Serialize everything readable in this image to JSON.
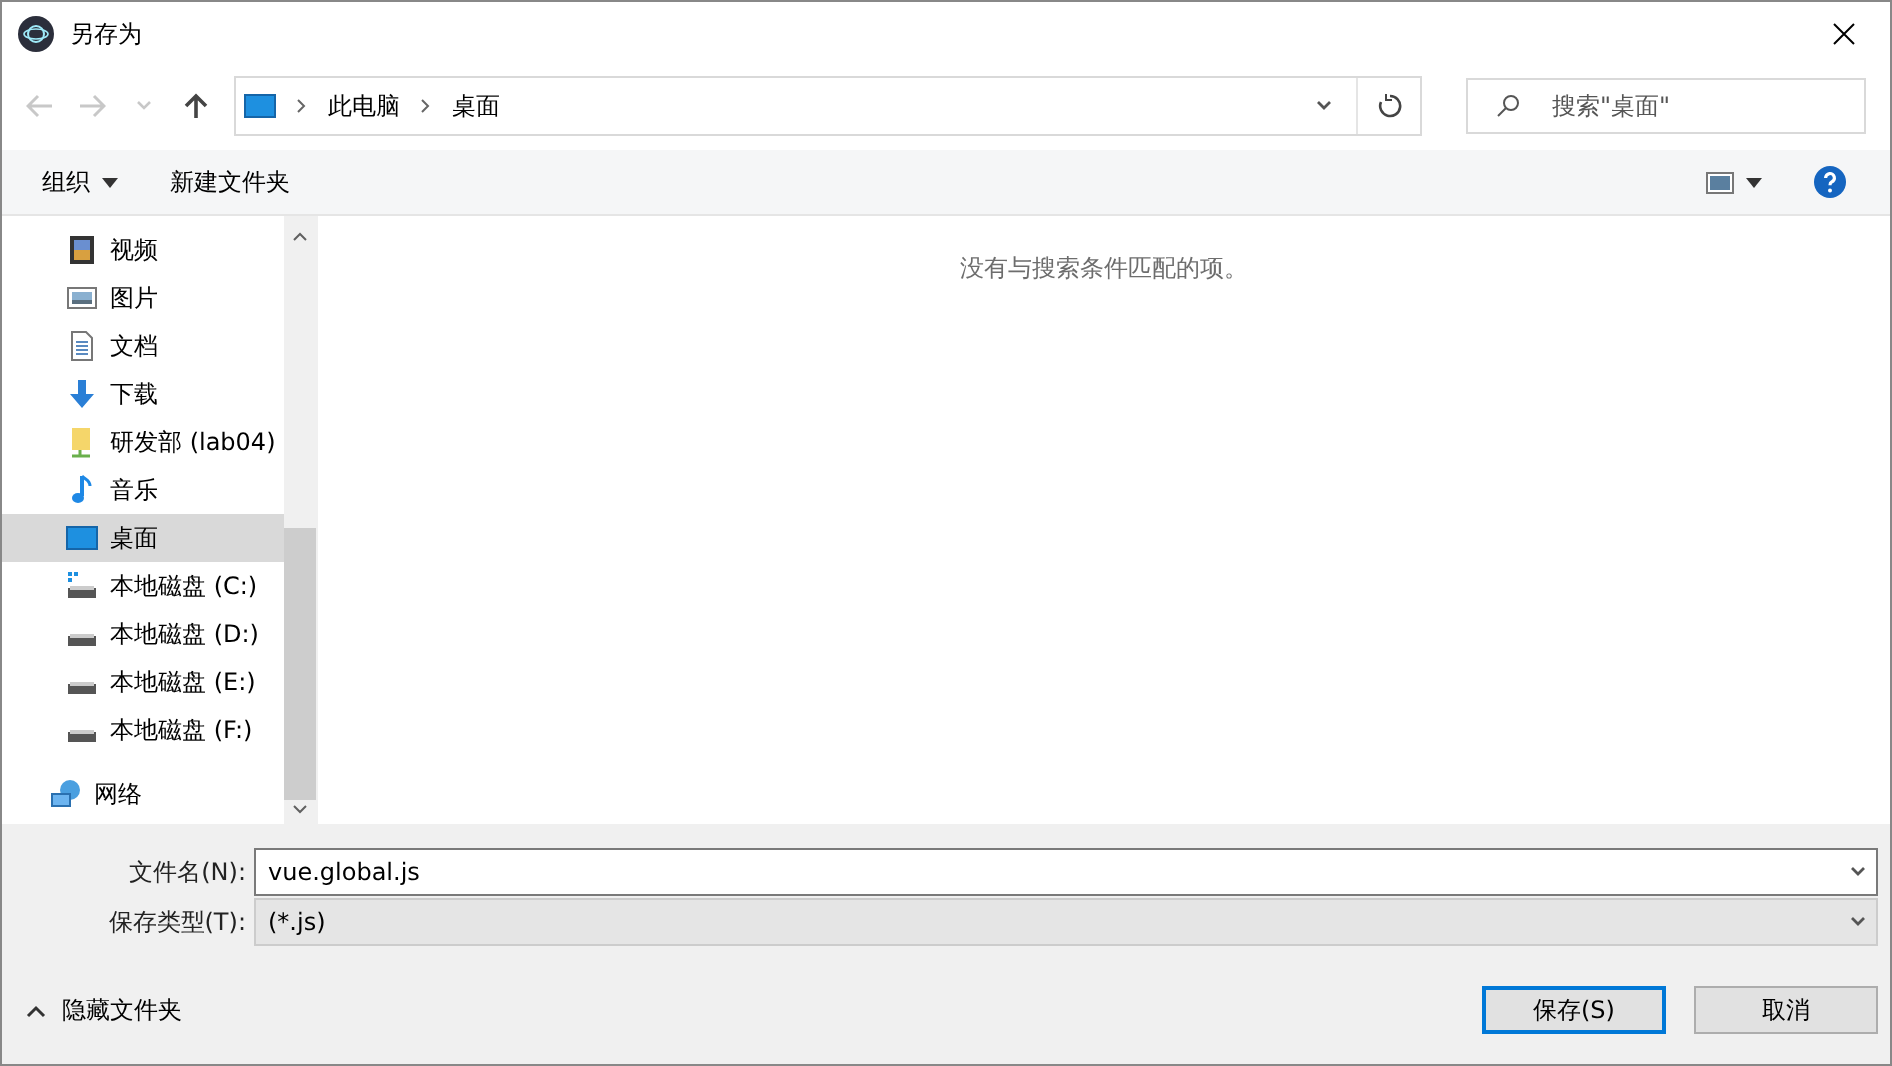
{
  "window": {
    "title": "另存为"
  },
  "nav_buttons": [
    {
      "kind": "back",
      "disabled": true
    },
    {
      "kind": "forward",
      "disabled": true
    },
    {
      "kind": "recent",
      "disabled": true
    },
    {
      "kind": "up",
      "disabled": false
    }
  ],
  "breadcrumb": [
    "此电脑",
    "桌面"
  ],
  "search": {
    "placeholder": "搜索\"桌面\""
  },
  "toolbar": {
    "organize": "组织",
    "new_folder": "新建文件夹"
  },
  "sidebar": {
    "groups": [
      {
        "indented": true,
        "items": [
          {
            "label": "视频",
            "kind": "video",
            "selected": false
          },
          {
            "label": "图片",
            "kind": "pictures",
            "selected": false
          },
          {
            "label": "文档",
            "kind": "documents",
            "selected": false
          },
          {
            "label": "下载",
            "kind": "downloads",
            "selected": false
          },
          {
            "label": "研发部 (lab04)",
            "kind": "share",
            "selected": false
          },
          {
            "label": "音乐",
            "kind": "music",
            "selected": false
          },
          {
            "label": "桌面",
            "kind": "desktop",
            "selected": true
          },
          {
            "label": "本地磁盘 (C:)",
            "kind": "system-drive",
            "selected": false
          },
          {
            "label": "本地磁盘 (D:)",
            "kind": "drive",
            "selected": false
          },
          {
            "label": "本地磁盘 (E:)",
            "kind": "drive",
            "selected": false
          },
          {
            "label": "本地磁盘 (F:)",
            "kind": "drive",
            "selected": false
          }
        ]
      },
      {
        "indented": false,
        "items": [
          {
            "label": "网络",
            "kind": "network",
            "selected": false
          }
        ]
      }
    ]
  },
  "empty_message": "没有与搜索条件匹配的项。",
  "form": {
    "file_name_label": "文件名(N):",
    "file_name": "vue.global.js",
    "type_label": "保存类型(T):",
    "type": "(*.js)"
  },
  "hide_folders": "隐藏文件夹",
  "buttons": [
    {
      "label": "保存(S)",
      "kind": "primary"
    },
    {
      "label": "取消",
      "kind": "secondary"
    }
  ]
}
